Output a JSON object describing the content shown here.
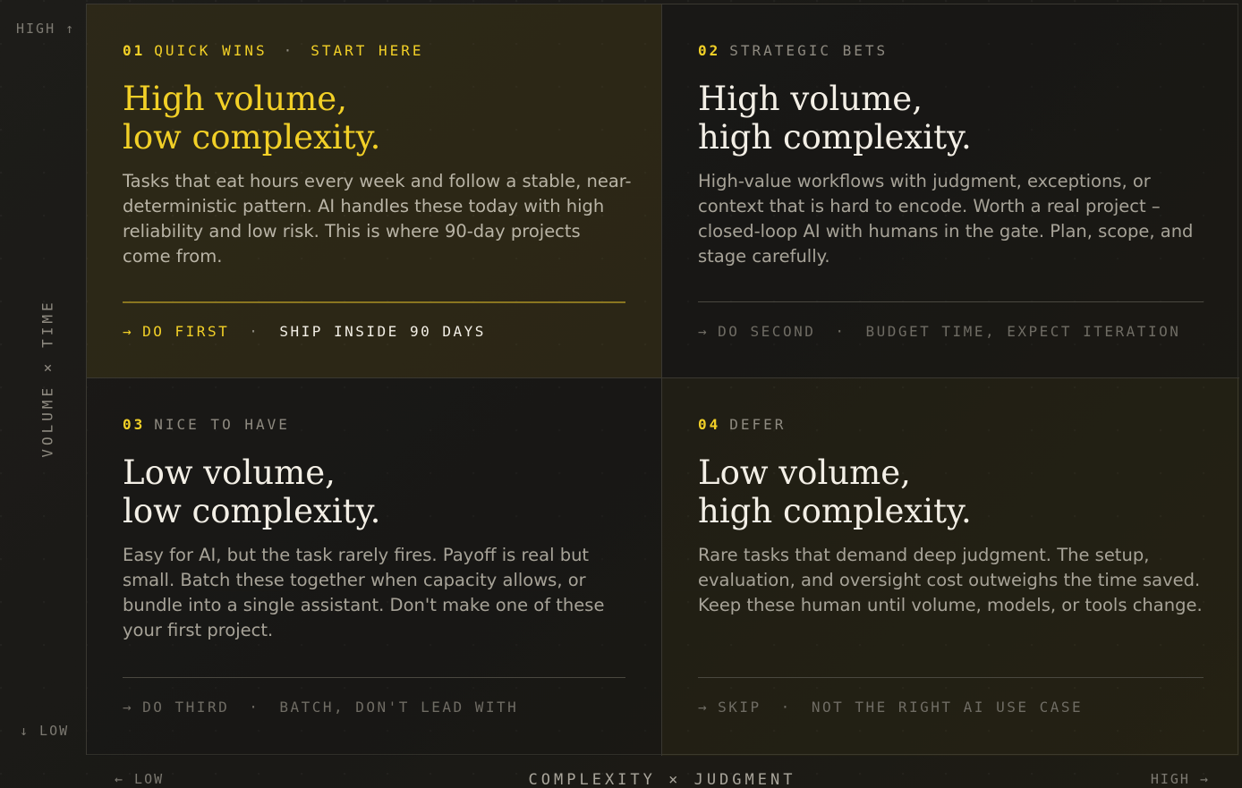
{
  "axes": {
    "y_high": "HIGH ↑",
    "y_low": "↓ LOW",
    "y_title": "VOLUME × TIME",
    "x_low": "← LOW",
    "x_high": "HIGH →",
    "x_title": "COMPLEXITY × JUDGMENT"
  },
  "colors": {
    "accent": "#f2d027",
    "background": "#1b1a17",
    "muted": "#8e8a80"
  },
  "quadrants": [
    {
      "number": "01",
      "label": "QUICK WINS",
      "extra": "START HERE",
      "title_line1": "High volume,",
      "title_line2": "low complexity.",
      "description": "Tasks that eat hours every week and follow a stable, near-deterministic pattern. AI handles these today with high reliability and low risk. This is where 90-day projects come from.",
      "arrow": "→",
      "action": "DO FIRST",
      "note": "SHIP INSIDE 90 DAYS"
    },
    {
      "number": "02",
      "label": "STRATEGIC BETS",
      "extra": "",
      "title_line1": "High volume,",
      "title_line2": "high complexity.",
      "description": "High-value workflows with judgment, exceptions, or context that is hard to encode. Worth a real project – closed-loop AI with humans in the gate. Plan, scope, and stage carefully.",
      "arrow": "→",
      "action": "DO SECOND",
      "note": "BUDGET TIME, EXPECT ITERATION"
    },
    {
      "number": "03",
      "label": "NICE TO HAVE",
      "extra": "",
      "title_line1": "Low volume,",
      "title_line2": "low complexity.",
      "description": "Easy for AI, but the task rarely fires. Payoff is real but small. Batch these together when capacity allows, or bundle into a single assistant. Don't make one of these your first project.",
      "arrow": "→",
      "action": "DO THIRD",
      "note": "BATCH, DON'T LEAD WITH"
    },
    {
      "number": "04",
      "label": "DEFER",
      "extra": "",
      "title_line1": "Low volume,",
      "title_line2": "high complexity.",
      "description": "Rare tasks that demand deep judgment. The setup, evaluation, and oversight cost outweighs the time saved. Keep these human until volume, models, or tools change.",
      "arrow": "→",
      "action": "SKIP",
      "note": "NOT THE RIGHT AI USE CASE"
    }
  ]
}
